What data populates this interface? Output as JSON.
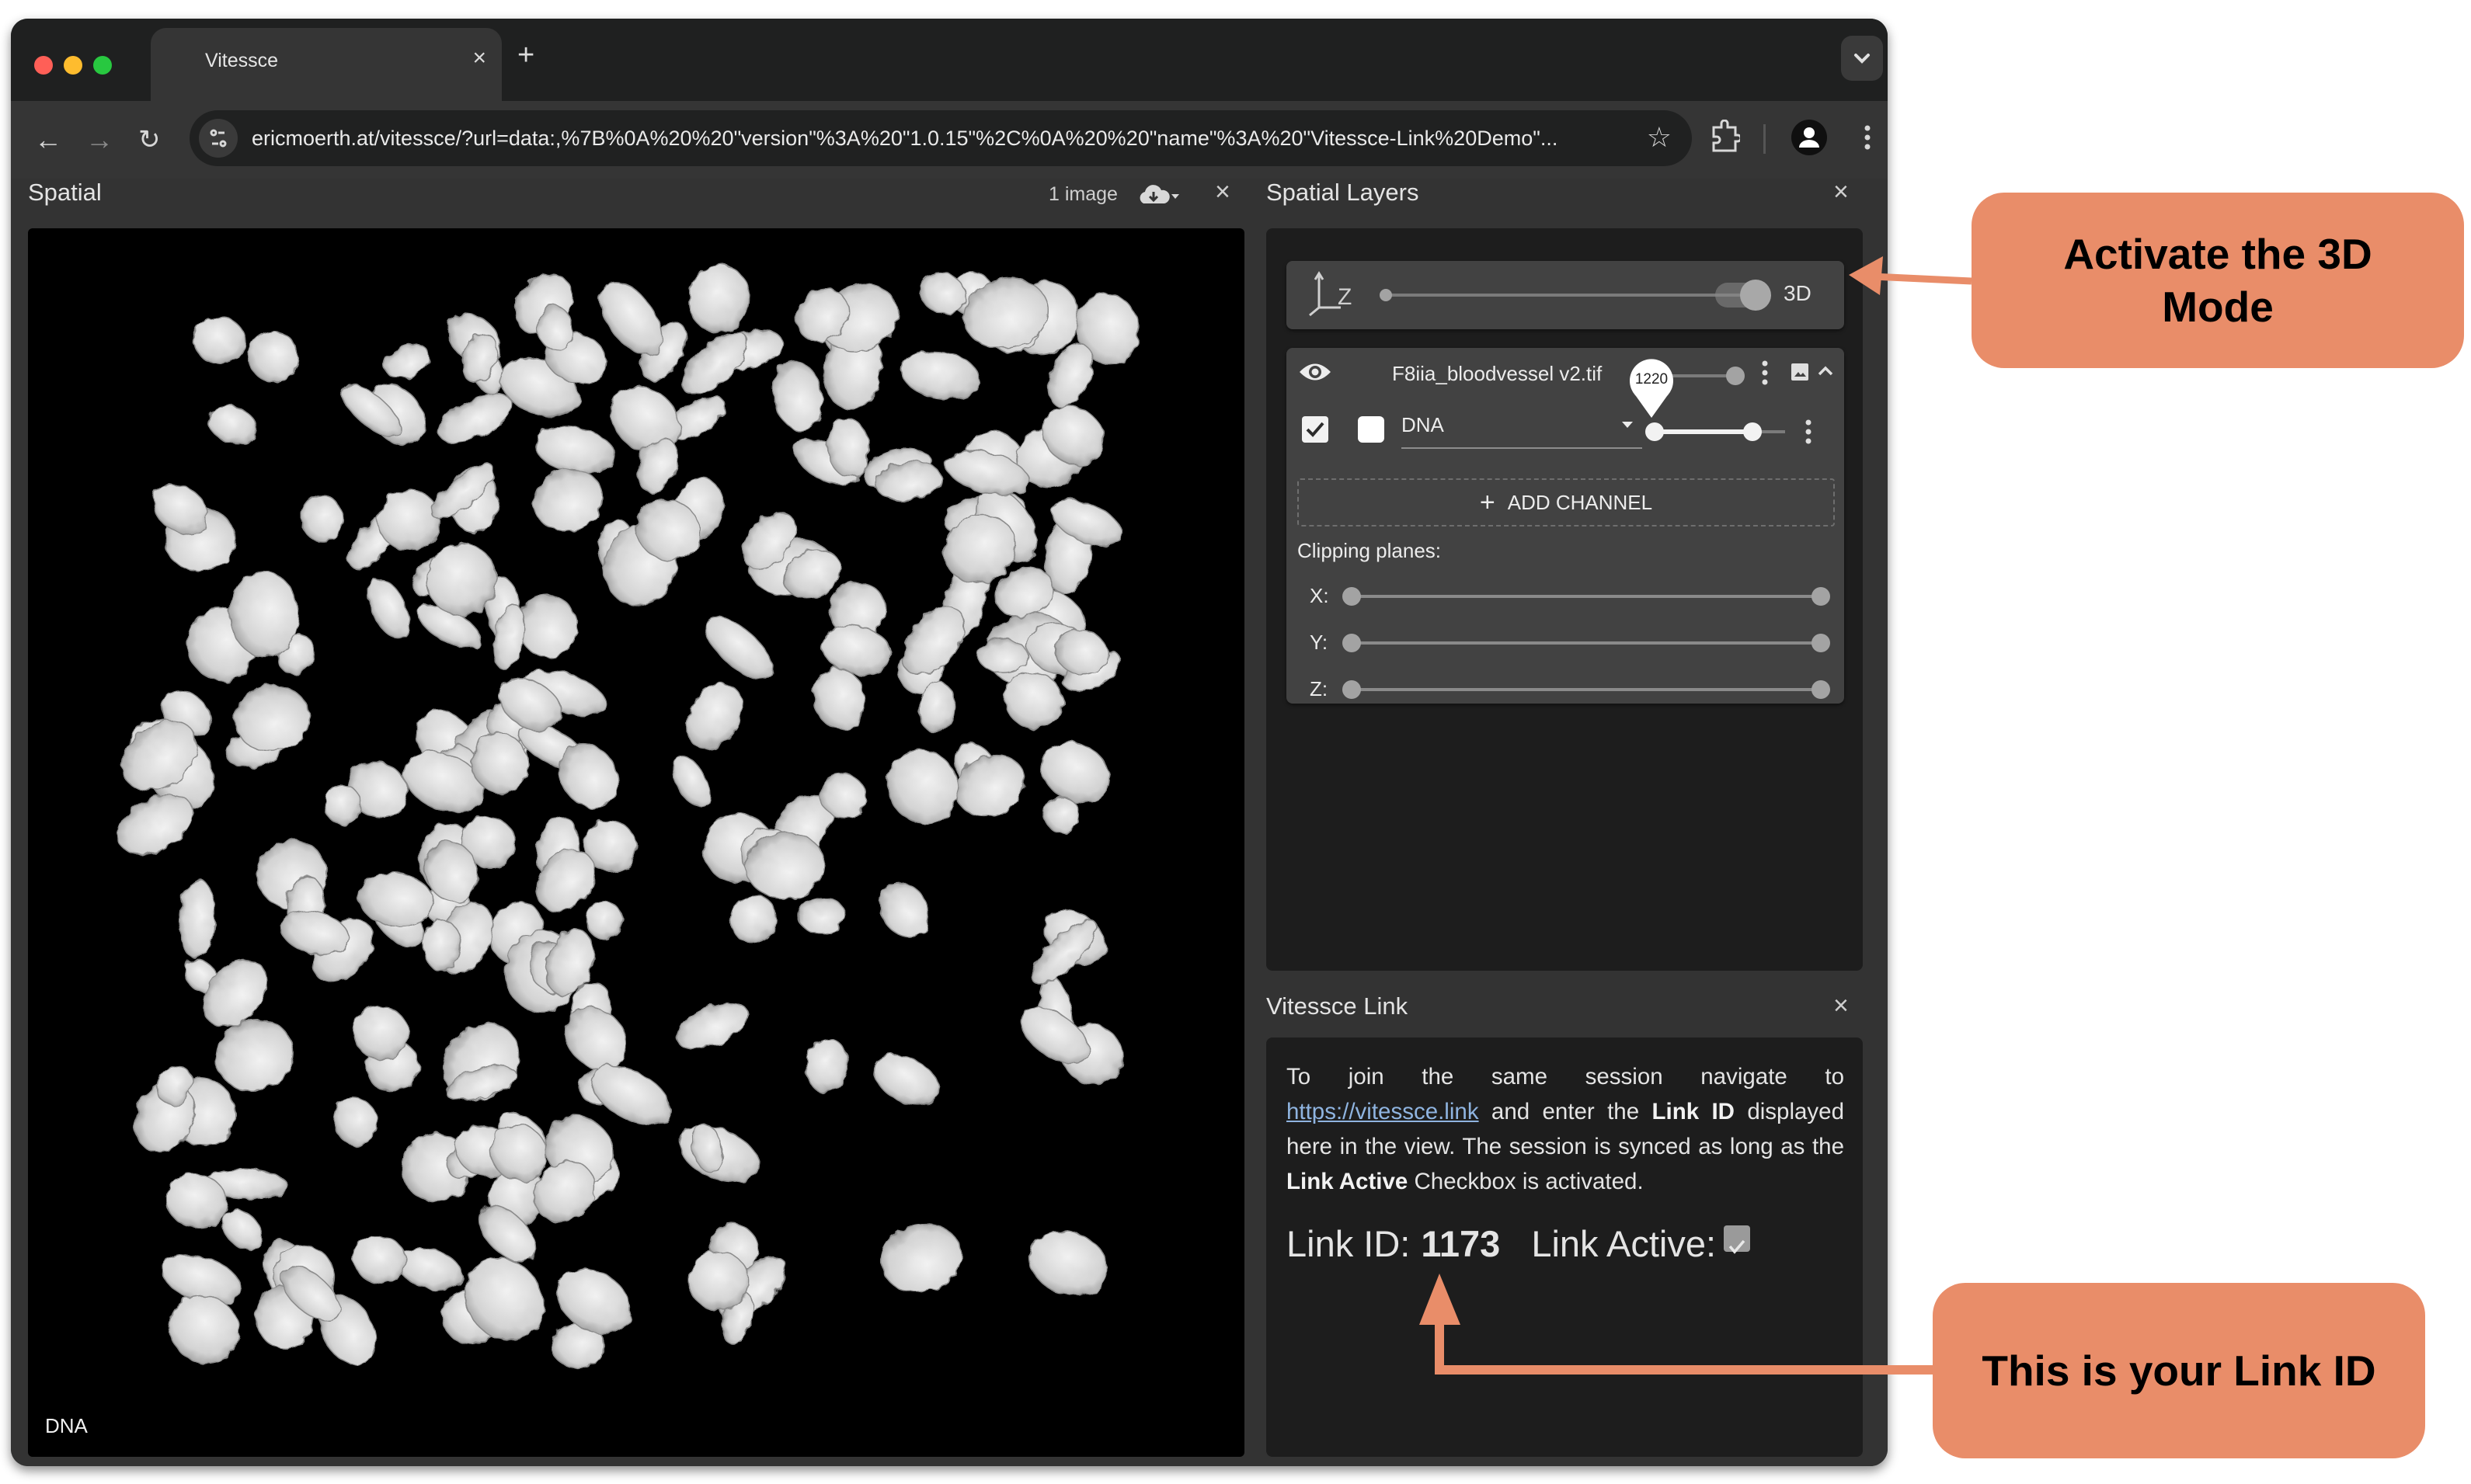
{
  "browser": {
    "tab_title": "Vitessce",
    "tab_close": "×",
    "new_tab": "+",
    "url": "ericmoerth.at/vitessce/?url=data:,%7B%0A%20%20\"version\"%3A%20\"1.0.15\"%2C%0A%20%20\"name\"%3A%20\"Vitessce-Link%20Demo\"...",
    "traffic_light_colors": [
      "#ff5f57",
      "#febc2e",
      "#28c840"
    ]
  },
  "spatial": {
    "title": "Spatial",
    "image_count": "1 image",
    "close": "×",
    "channel_label": "DNA"
  },
  "spatial_layers": {
    "title": "Spatial Layers",
    "close": "×",
    "dimension_axis": "Z",
    "dimension_mode": "3D",
    "dimension_toggle_value": 1,
    "layer": {
      "name": "F8iia_bloodvessel v2.tif",
      "opacity_value": 1,
      "tooltip_value": "1220",
      "channels": [
        {
          "name": "DNA",
          "visible": true,
          "color": "#ffffff",
          "range_min_fraction": 0.0,
          "range_max_fraction": 0.75
        }
      ]
    },
    "add_channel_label": "ADD CHANNEL",
    "clipping_planes_label": "Clipping planes:",
    "clipping_planes": [
      {
        "axis": "X:",
        "min": 0,
        "max": 1
      },
      {
        "axis": "Y:",
        "min": 0,
        "max": 1
      },
      {
        "axis": "Z:",
        "min": 0,
        "max": 1
      }
    ]
  },
  "vitessce_link": {
    "title": "Vitessce Link",
    "close": "×",
    "text_part1": "To join the same session navigate to ",
    "link_url": "https://vitessce.link",
    "text_part2": " and enter the ",
    "bold1": "Link ID",
    "text_part3": " displayed here in the view. The session is synced as long as the ",
    "bold2": "Link Active",
    "text_part4": " Checkbox is activated.",
    "link_id_label": "Link ID:",
    "link_id_value": "1173",
    "link_active_label": "Link Active:",
    "link_active": true
  },
  "annotations": {
    "callout_3d": "Activate the 3D Mode",
    "callout_link": "This is your Link ID",
    "color": "#e98d69"
  }
}
